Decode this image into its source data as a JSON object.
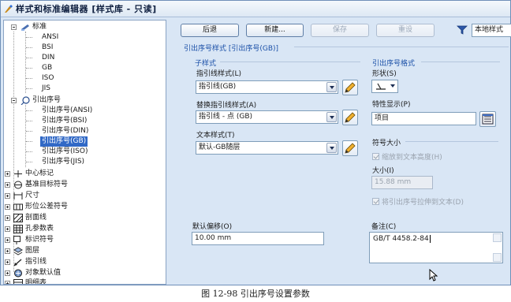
{
  "window": {
    "title": "样式和标准编辑器 [样式库 - 只读]"
  },
  "tree": {
    "items": [
      {
        "label": "标准",
        "level": 0,
        "expander": "minus",
        "icon": "standard-icon"
      },
      {
        "label": "ANSI",
        "level": 1
      },
      {
        "label": "BSI",
        "level": 1
      },
      {
        "label": "DIN",
        "level": 1
      },
      {
        "label": "GB",
        "level": 1
      },
      {
        "label": "ISO",
        "level": 1
      },
      {
        "label": "JIS",
        "level": 1
      },
      {
        "label": "引出序号",
        "level": 0,
        "expander": "minus",
        "icon": "balloon-icon"
      },
      {
        "label": "引出序号(ANSI)",
        "level": 1
      },
      {
        "label": "引出序号(BSI)",
        "level": 1
      },
      {
        "label": "引出序号(DIN)",
        "level": 1
      },
      {
        "label": "引出序号(GB)",
        "level": 1,
        "selected": true
      },
      {
        "label": "引出序号(ISO)",
        "level": 1
      },
      {
        "label": "引出序号(JIS)",
        "level": 1
      },
      {
        "label": "中心标记",
        "level": 0,
        "expander": "plus",
        "icon": "center-mark-icon"
      },
      {
        "label": "基准目标符号",
        "level": 0,
        "expander": "plus",
        "icon": "datum-target-icon"
      },
      {
        "label": "尺寸",
        "level": 0,
        "expander": "plus",
        "icon": "dimension-icon"
      },
      {
        "label": "形位公差符号",
        "level": 0,
        "expander": "plus",
        "icon": "fcf-icon"
      },
      {
        "label": "剖面线",
        "level": 0,
        "expander": "plus",
        "icon": "hatch-icon"
      },
      {
        "label": "孔参数表",
        "level": 0,
        "expander": "plus",
        "icon": "hole-table-icon"
      },
      {
        "label": "标识符号",
        "level": 0,
        "expander": "plus",
        "icon": "identifier-icon"
      },
      {
        "label": "图层",
        "level": 0,
        "expander": "plus",
        "icon": "layer-icon"
      },
      {
        "label": "指引线",
        "level": 0,
        "expander": "plus",
        "icon": "leader-icon"
      },
      {
        "label": "对象默认值",
        "level": 0,
        "expander": "plus",
        "icon": "object-defaults-icon"
      },
      {
        "label": "明细表",
        "level": 0,
        "expander": "plus",
        "icon": "parts-list-icon"
      }
    ]
  },
  "toolbar": {
    "back_label": "后退",
    "new_label": "新建...",
    "save_label": "保存",
    "reset_label": "重设",
    "filter_value": "本地样式"
  },
  "main": {
    "section_title": "引出序号样式 [引出序号(GB)]",
    "sub_style": {
      "title": "子样式",
      "leader_label": "指引线样式(L)",
      "leader_value": "指引线(GB)",
      "alt_leader_label": "替换指引线样式(A)",
      "alt_leader_value": "指引线 - 点 (GB)",
      "text_label": "文本样式(T)",
      "text_value": "默认-GB随层"
    },
    "balloon_format": {
      "title": "引出序号格式",
      "shape_label": "形状(S)",
      "property_label": "特性显示(P)",
      "property_value": "项目",
      "symbol_size_title": "符号大小",
      "scale_to_text_label": "缩放到文本高度(H)",
      "size_label": "大小(I)",
      "size_value": "15.88 mm",
      "fit_text_label": "将引出序号拉伸到文本(D)"
    },
    "offset_label": "默认偏移(O)",
    "offset_value": "10.00 mm",
    "comment_label": "备注(C)",
    "comment_value": "GB/T 4458.2-84"
  },
  "caption": "图 12-98  引出序号设置参数"
}
